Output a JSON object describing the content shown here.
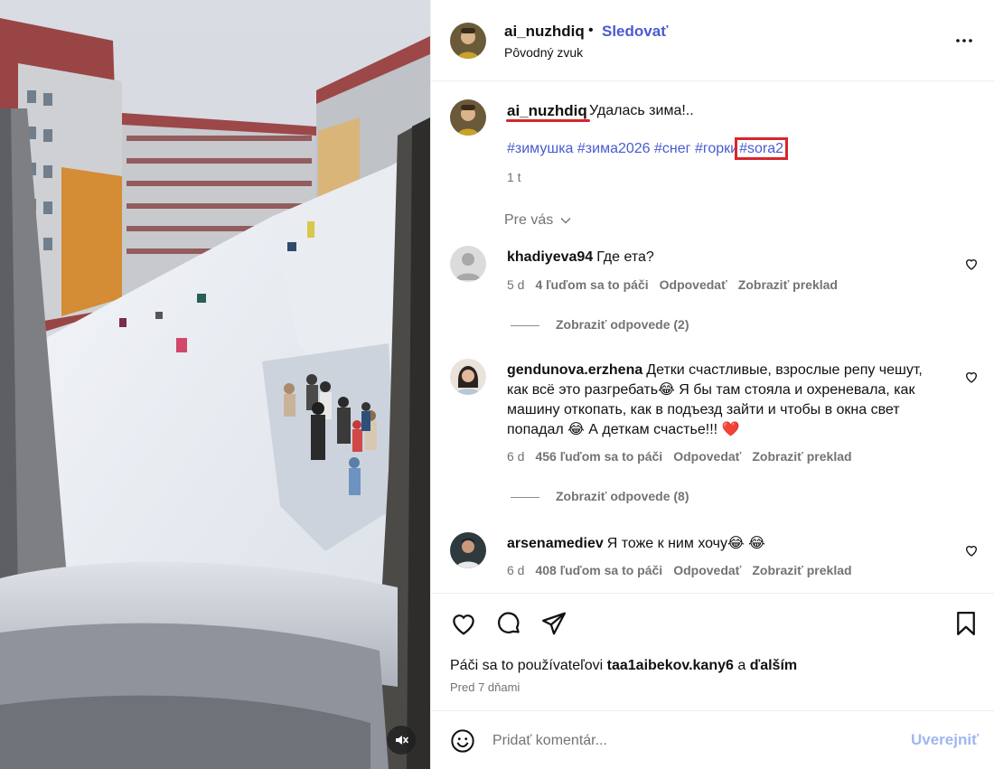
{
  "post": {
    "username": "ai_nuzhdiq",
    "follow_label": "Sledovať",
    "separator": "•",
    "audio_label": "Pôvodný zvuk"
  },
  "caption": {
    "username": "ai_nuzhdiq",
    "text": "Удалась зима!..",
    "hashtags": [
      "#зимушка",
      "#зима2026",
      "#снег",
      "#горки",
      "#sora2"
    ],
    "time": "1 t"
  },
  "comments_header": {
    "sort_label": "Pre vás"
  },
  "comments": [
    {
      "username": "khadiyeva94",
      "text": "Где ета?",
      "time": "5 d",
      "likes": "4 ľuďom sa to páči",
      "reply_label": "Odpovedať",
      "translate_label": "Zobraziť preklad",
      "replies_label": "Zobraziť odpovede (2)"
    },
    {
      "username": "gendunova.erzhena",
      "text": "Детки счастливые, взрослые репу чешут, как всё это разгребать😂 Я бы там стояла и охреневала, как машину откопать, как в подъезд зайти и чтобы в окна свет попадал 😂 А деткам счастье!!! ❤️",
      "time": "6 d",
      "likes": "456 ľuďom sa to páči",
      "reply_label": "Odpovedať",
      "translate_label": "Zobraziť preklad",
      "replies_label": "Zobraziť odpovede (8)"
    },
    {
      "username": "arsenamediev",
      "text": "Я тоже к ним хочу😂 😂",
      "time": "6 d",
      "likes": "408 ľuďom sa to páči",
      "reply_label": "Odpovedať",
      "translate_label": "Zobraziť preklad"
    }
  ],
  "actions": {
    "likes_prefix": "Páči sa to používateľovi",
    "liked_by": "taa1aibekov.kany6",
    "likes_and": "a",
    "likes_others": "ďalším",
    "post_date": "Pred 7 dňami"
  },
  "composer": {
    "placeholder": "Pridať komentár...",
    "post_label": "Uverejniť"
  },
  "icons": {
    "more": "more-icon",
    "mute": "muted-speaker-icon",
    "like": "heart-icon",
    "comment": "comment-icon",
    "share": "share-icon",
    "save": "bookmark-icon",
    "emoji": "emoji-icon"
  },
  "colors": {
    "link_blue": "#4a5bd0",
    "highlight_red": "#d7262b",
    "muted_gray": "#737373",
    "post_button": "#9fb6f2"
  }
}
